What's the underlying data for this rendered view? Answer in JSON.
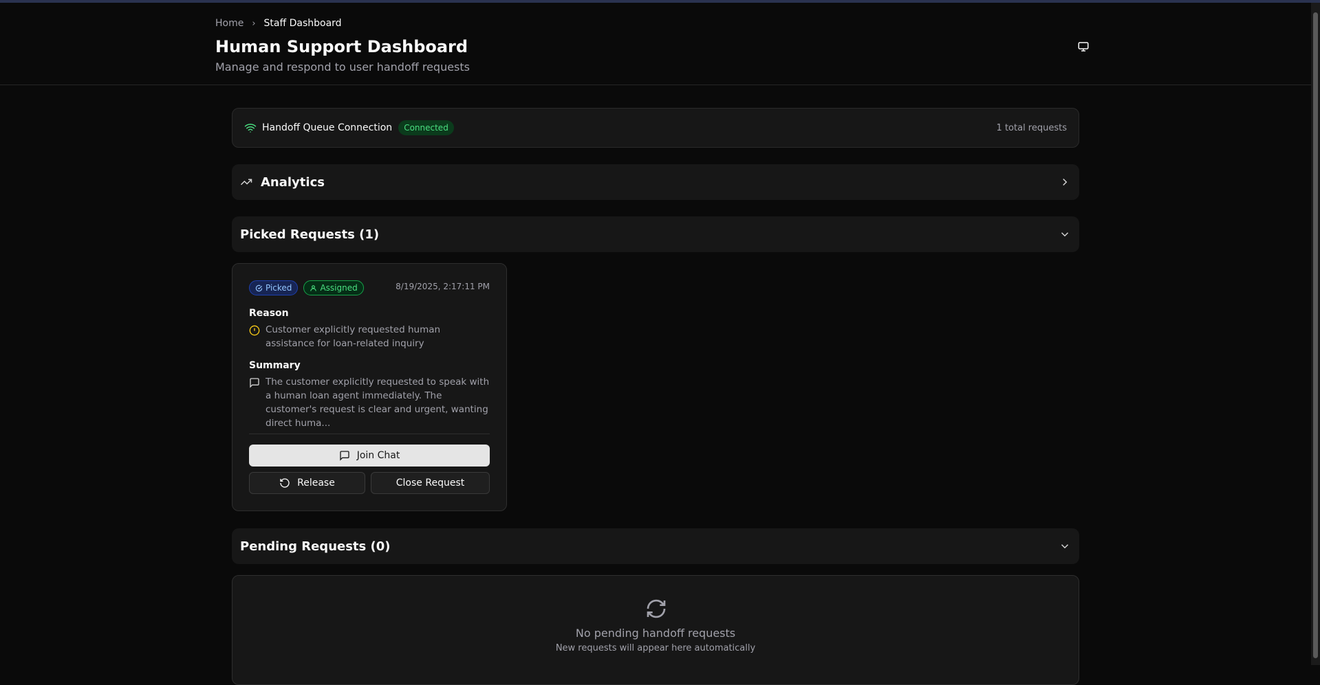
{
  "breadcrumb": {
    "home": "Home",
    "current": "Staff Dashboard"
  },
  "header": {
    "title": "Human Support Dashboard",
    "subtitle": "Manage and respond to user handoff requests"
  },
  "connection": {
    "label": "Handoff Queue Connection",
    "status": "Connected",
    "total": "1 total requests"
  },
  "analytics": {
    "label": "Analytics"
  },
  "picked": {
    "label": "Picked Requests (1)",
    "request": {
      "badge_picked": "Picked",
      "badge_assigned": "Assigned",
      "timestamp": "8/19/2025, 2:17:11 PM",
      "reason_label": "Reason",
      "reason": "Customer explicitly requested human assistance for loan-related inquiry",
      "summary_label": "Summary",
      "summary": "The customer explicitly requested to speak with a human loan agent immediately. The customer's request is clear and urgent, wanting direct huma...",
      "join": "Join Chat",
      "release": "Release",
      "close": "Close Request"
    }
  },
  "pending": {
    "label": "Pending Requests (0)",
    "empty_title": "No pending handoff requests",
    "empty_sub": "New requests will appear here automatically"
  },
  "colors": {
    "accent_green": "#4ade80",
    "accent_blue": "#93c5fd",
    "warning": "#facc15"
  }
}
